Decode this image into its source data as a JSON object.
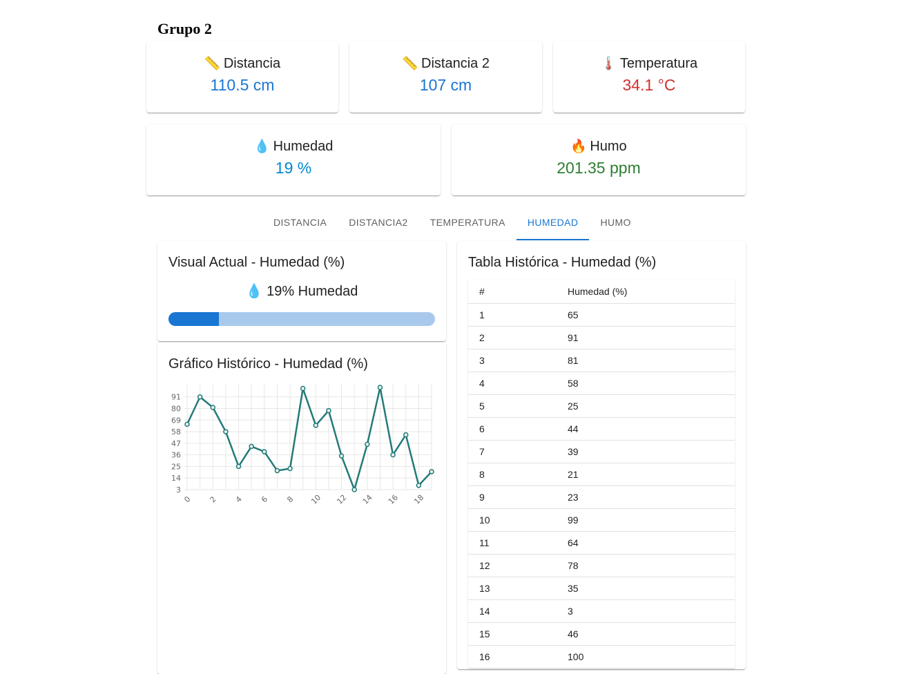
{
  "page_title": "Grupo 2",
  "sensors": [
    {
      "icon": "📏",
      "icon_name": "ruler-icon",
      "label": "Distancia",
      "value": "110.5 cm",
      "color": "#1976d2"
    },
    {
      "icon": "📏",
      "icon_name": "ruler-icon",
      "label": "Distancia 2",
      "value": "107 cm",
      "color": "#1976d2"
    },
    {
      "icon": "🌡️",
      "icon_name": "thermometer-icon",
      "label": "Temperatura",
      "value": "34.1 °C",
      "color": "#d32f2f"
    },
    {
      "icon": "💧",
      "icon_name": "droplet-icon",
      "label": "Humedad",
      "value": "19 %",
      "color": "#0288d1"
    },
    {
      "icon": "🔥",
      "icon_name": "fire-icon",
      "label": "Humo",
      "value": "201.35 ppm",
      "color": "#2e7d32"
    }
  ],
  "tabs": [
    {
      "label": "DISTANCIA",
      "active": false
    },
    {
      "label": "DISTANCIA2",
      "active": false
    },
    {
      "label": "TEMPERATURA",
      "active": false
    },
    {
      "label": "HUMEDAD",
      "active": true
    },
    {
      "label": "HUMO",
      "active": false
    }
  ],
  "visual": {
    "title": "Visual Actual - Humedad (%)",
    "icon": "💧",
    "icon_name": "droplet-icon",
    "current_text": "19% Humedad",
    "progress_fraction": 0.19
  },
  "history_chart": {
    "title": "Gráfico Histórico - Humedad (%)"
  },
  "history_table": {
    "title": "Tabla Histórica - Humedad (%)",
    "columns": [
      "#",
      "Humedad (%)"
    ],
    "rows": [
      [
        "1",
        "65"
      ],
      [
        "2",
        "91"
      ],
      [
        "3",
        "81"
      ],
      [
        "4",
        "58"
      ],
      [
        "5",
        "25"
      ],
      [
        "6",
        "44"
      ],
      [
        "7",
        "39"
      ],
      [
        "8",
        "21"
      ],
      [
        "9",
        "23"
      ],
      [
        "10",
        "99"
      ],
      [
        "11",
        "64"
      ],
      [
        "12",
        "78"
      ],
      [
        "13",
        "35"
      ],
      [
        "14",
        "3"
      ],
      [
        "15",
        "46"
      ],
      [
        "16",
        "100"
      ]
    ]
  },
  "chart_data": {
    "type": "line",
    "x": [
      0,
      1,
      2,
      3,
      4,
      5,
      6,
      7,
      8,
      9,
      10,
      11,
      12,
      13,
      14,
      15,
      16,
      17,
      18,
      19
    ],
    "series": [
      {
        "values": [
          65,
          91,
          81,
          58,
          25,
          44,
          39,
          21,
          23,
          99,
          64,
          78,
          35,
          3,
          46,
          100,
          36,
          55,
          7,
          20
        ],
        "color": "#227a78"
      }
    ],
    "x_ticks": [
      "0",
      "2",
      "4",
      "6",
      "8",
      "10",
      "12",
      "14",
      "16",
      "18"
    ],
    "y_ticks": [
      "3",
      "14",
      "25",
      "36",
      "47",
      "58",
      "69",
      "80",
      "91"
    ],
    "ylim": [
      3,
      100
    ],
    "xlim": [
      0,
      19
    ],
    "grid": true
  }
}
